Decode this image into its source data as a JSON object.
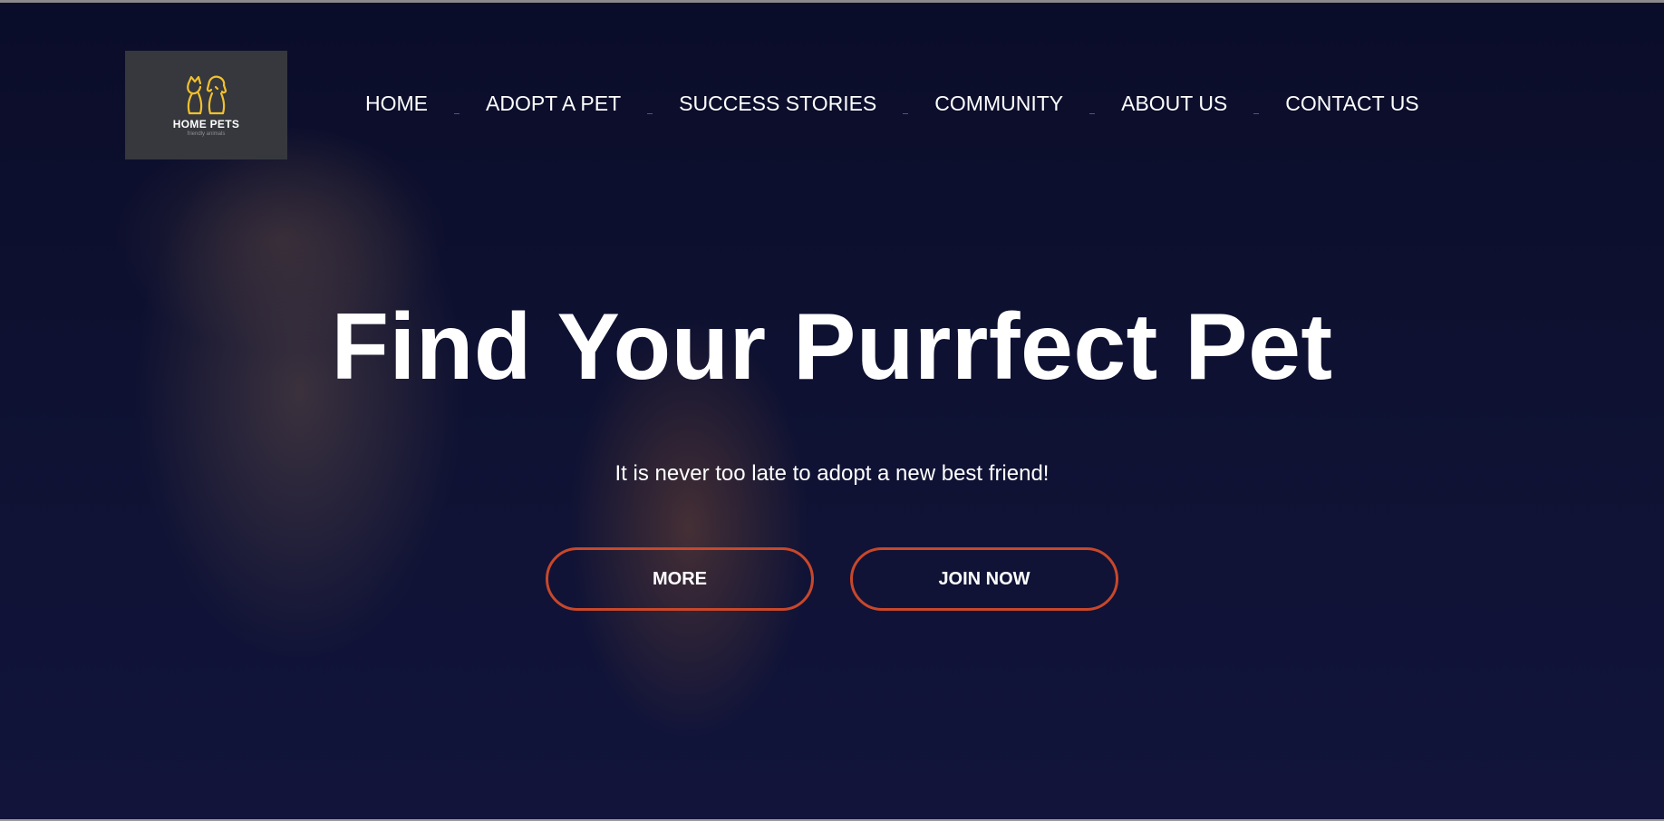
{
  "brand": {
    "name": "HOME PETS",
    "tagline": "friendly animals",
    "accent_color": "#f2c12e",
    "icon": "pets-icon"
  },
  "nav": {
    "items": [
      {
        "label": "HOME"
      },
      {
        "label": "ADOPT A PET"
      },
      {
        "label": "SUCCESS STORIES"
      },
      {
        "label": "COMMUNITY"
      },
      {
        "label": "ABOUT US"
      },
      {
        "label": "CONTACT US"
      }
    ],
    "separator_color": "#5b3fd0"
  },
  "hero": {
    "title": "Find Your Purrfect Pet",
    "subtitle": "It is never too late to adopt a new best friend!",
    "buttons": {
      "more": "MORE",
      "join": "JOIN NOW"
    },
    "button_border_color": "#c8472b"
  }
}
